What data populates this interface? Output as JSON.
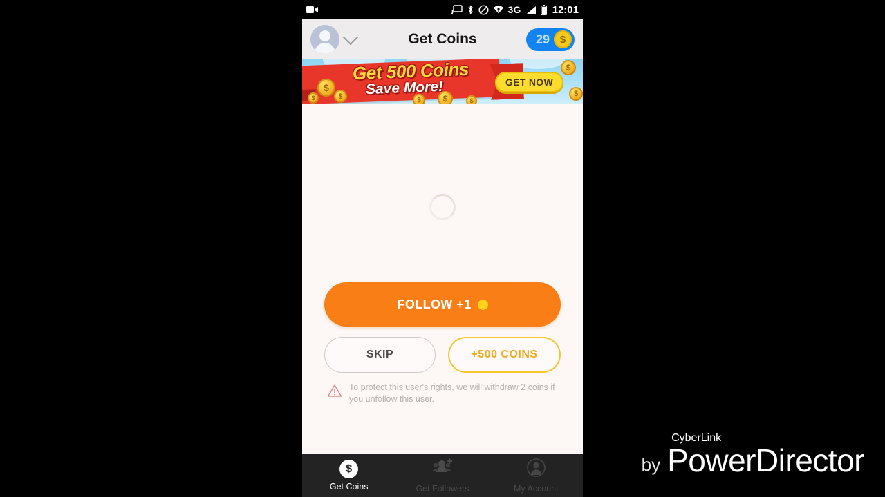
{
  "status_bar": {
    "recording_icon": "camcorder-icon",
    "icons": [
      "cast-icon",
      "bluetooth-icon",
      "do-not-disturb-icon",
      "wifi-icon"
    ],
    "network": "3G",
    "signal_icon": "signal-bars-icon",
    "battery_icon": "battery-icon",
    "time": "12:01"
  },
  "header": {
    "avatar": "user-avatar",
    "dropdown_icon": "chevron-down-icon",
    "title": "Get Coins",
    "coin_count": "29",
    "coin_symbol": "$"
  },
  "banner": {
    "line1": "Get 500 Coins",
    "line2": "Save More!",
    "cta": "GET NOW",
    "coin_symbol": "$",
    "ribbon_color": "#e8362a",
    "title_color": "#ffd93b",
    "cta_color": "#fcdc2e",
    "sky_color": "#a9e0f7"
  },
  "content": {
    "loading": "loading-spinner",
    "background_color": "#fdf8f6"
  },
  "actions": {
    "follow_label": "FOLLOW +1",
    "follow_coin": "coin-icon",
    "follow_color": "#f87e15",
    "skip_label": "SKIP",
    "coins_label": "+500 COINS",
    "coins_color": "#f0a81d",
    "warning_icon": "warning-triangle-icon",
    "warning_text": "To protect this user's rights, we will withdraw 2 coins if you unfollow this user."
  },
  "bottom_nav": {
    "items": [
      {
        "label": "Get Coins",
        "icon": "coin-dollar-icon",
        "state": "active"
      },
      {
        "label": "Get Followers",
        "icon": "add-people-icon",
        "state": "inactive"
      },
      {
        "label": "My Account",
        "icon": "account-circle-icon",
        "state": "inactive"
      }
    ]
  },
  "watermark": {
    "by": "by",
    "brand": "CyberLink",
    "product": "PowerDirector"
  }
}
